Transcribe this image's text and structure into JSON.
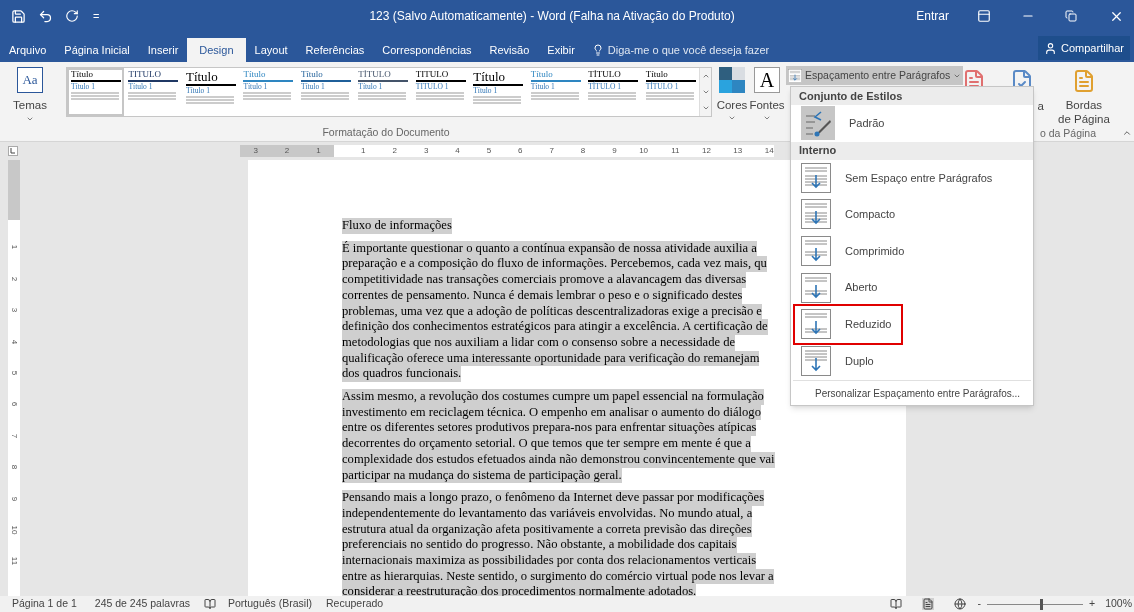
{
  "title_bar": {
    "customize": "=",
    "title": "123 (Salvo Automaticamente)  -  Word (Falha na Ativação do Produto)",
    "sign_in": "Entrar"
  },
  "tabs": [
    {
      "label": "Arquivo",
      "selected": false
    },
    {
      "label": "Página Inicial",
      "selected": false
    },
    {
      "label": "Inserir",
      "selected": false
    },
    {
      "label": "Design",
      "selected": true
    },
    {
      "label": "Layout",
      "selected": false
    },
    {
      "label": "Referências",
      "selected": false
    },
    {
      "label": "Correspondências",
      "selected": false
    },
    {
      "label": "Revisão",
      "selected": false
    },
    {
      "label": "Exibir",
      "selected": false
    }
  ],
  "tell_me": {
    "placeholder": "Diga-me o que você deseja fazer"
  },
  "share_button": "Compartilhar",
  "ribbon": {
    "themes_icon_text": "Aa",
    "themes_label": "Temas",
    "gallery": [
      {
        "title": "Título",
        "heading": "Título 1",
        "color": "#000000",
        "selected": true
      },
      {
        "title": "TITULO",
        "heading": "Título 1",
        "color": "#1f3864",
        "selected": false
      },
      {
        "title": "Título",
        "heading": "Título 1",
        "color": "#000000",
        "selected": false
      },
      {
        "title": "Título",
        "heading": "Título 1",
        "color": "#2e86c1",
        "selected": false
      },
      {
        "title": "Título",
        "heading": "Título 1",
        "color": "#1f5f99",
        "selected": false
      },
      {
        "title": "TÍTULO",
        "heading": "Título 1",
        "color": "#44546a",
        "selected": false
      },
      {
        "title": "TITULO",
        "heading": "TITULO 1",
        "color": "#000000",
        "selected": false
      },
      {
        "title": "Título",
        "heading": "Título 1",
        "color": "#000000",
        "selected": false
      },
      {
        "title": "Título",
        "heading": "Título 1",
        "color": "#2e86c1",
        "selected": false
      },
      {
        "title": "TÍTULO",
        "heading": "TÍTULO 1",
        "color": "#000000",
        "selected": false
      },
      {
        "title": "Título",
        "heading": "TÍTULO 1",
        "color": "#000000",
        "selected": false
      }
    ],
    "colors_label": "Cores",
    "fonts_icon_text": "A",
    "fonts_label": "Fontes",
    "spacing_button": {
      "label": "Espaçamento entre Parágrafos",
      "expanded": true
    },
    "group_label": "Formatação do Documento",
    "page_color_label": "a",
    "borders_label": "Bordas",
    "borders_label_2": "de Página",
    "right_group_label": "o da Página"
  },
  "ruler": {
    "left_numbers": [
      "3",
      "2",
      "1"
    ],
    "right_numbers": [
      "1",
      "2",
      "3",
      "4",
      "5",
      "6",
      "7",
      "8",
      "9",
      "10",
      "11",
      "12",
      "13",
      "14"
    ]
  },
  "vertical_ruler": {
    "numbers": [
      "1",
      "2",
      "3",
      "4",
      "5",
      "6",
      "7",
      "8",
      "9",
      "10",
      "11"
    ]
  },
  "document": {
    "selected": true,
    "paragraphs": [
      {
        "lines": [
          "Fluxo de informações"
        ]
      },
      {
        "lines": [
          "É importante questionar o quanto a contínua expansão de nossa atividade auxilia a",
          "preparação e a composição do fluxo de informações. Percebemos, cada vez mais, qu",
          "competitividade nas transações comerciais promove a alavancagem das diversas",
          "correntes de pensamento. Nunca é demais lembrar o peso e o significado destes",
          "problemas, uma vez que a adoção de políticas descentralizadoras exige a precisão e",
          "definição dos conhecimentos estratégicos para atingir a excelência. A certificação de",
          "metodologias que nos auxiliam a lidar com o consenso sobre a necessidade de",
          "qualificação oferece uma interessante oportunidade para verificação do remanejam",
          "dos quadros funcionais."
        ]
      },
      {
        "lines": [
          "Assim mesmo, a revolução dos costumes cumpre um papel essencial na formulação",
          "investimento em reciclagem técnica. O empenho em analisar o aumento do diálogo",
          "entre os diferentes setores produtivos prepara-nos para enfrentar situações atípicas",
          "decorrentes do orçamento setorial. O que temos que ter sempre em mente é que a",
          "complexidade dos estudos efetuados ainda não demonstrou convincentemente que vai",
          "participar na mudança do sistema de participação geral."
        ]
      },
      {
        "lines": [
          "Pensando mais a longo prazo, o fenômeno da Internet deve passar por modificações",
          "independentemente do levantamento das variáveis envolvidas. No mundo atual, a",
          "estrutura atual da organização afeta positivamente a correta previsão das direções",
          "preferenciais no sentido do progresso. Não obstante, a mobilidade dos capitais",
          "internacionais maximiza as possibilidades por conta dos relacionamentos verticais",
          "entre as hierarquias. Neste sentido, o surgimento do comércio virtual pode nos levar a",
          "considerar a reestruturação dos procedimentos normalmente adotados."
        ]
      }
    ]
  },
  "menu": {
    "sections": [
      {
        "header": "Conjunto de Estilos",
        "items": [
          {
            "label": "Padrão",
            "selected": true,
            "outlined": false
          }
        ]
      },
      {
        "header": "Interno",
        "items": [
          {
            "label": "Sem Espaço entre Parágrafos",
            "selected": false,
            "outlined": false
          },
          {
            "label": "Compacto",
            "selected": false,
            "outlined": false
          },
          {
            "label": "Comprimido",
            "selected": false,
            "outlined": false
          },
          {
            "label": "Aberto",
            "selected": false,
            "outlined": false
          },
          {
            "label": "Reduzido",
            "selected": false,
            "outlined": true
          },
          {
            "label": "Duplo",
            "selected": false,
            "outlined": false
          }
        ]
      }
    ],
    "footer": "Personalizar Espaçamento entre Parágrafos..."
  },
  "status_bar": {
    "page": "Página 1 de 1",
    "words": "245 de 245 palavras",
    "language": "Português (Brasil)",
    "state": "Recuperado",
    "zoom": {
      "minus": "-",
      "plus": "+",
      "level": 0.55,
      "reading": "100%"
    }
  }
}
